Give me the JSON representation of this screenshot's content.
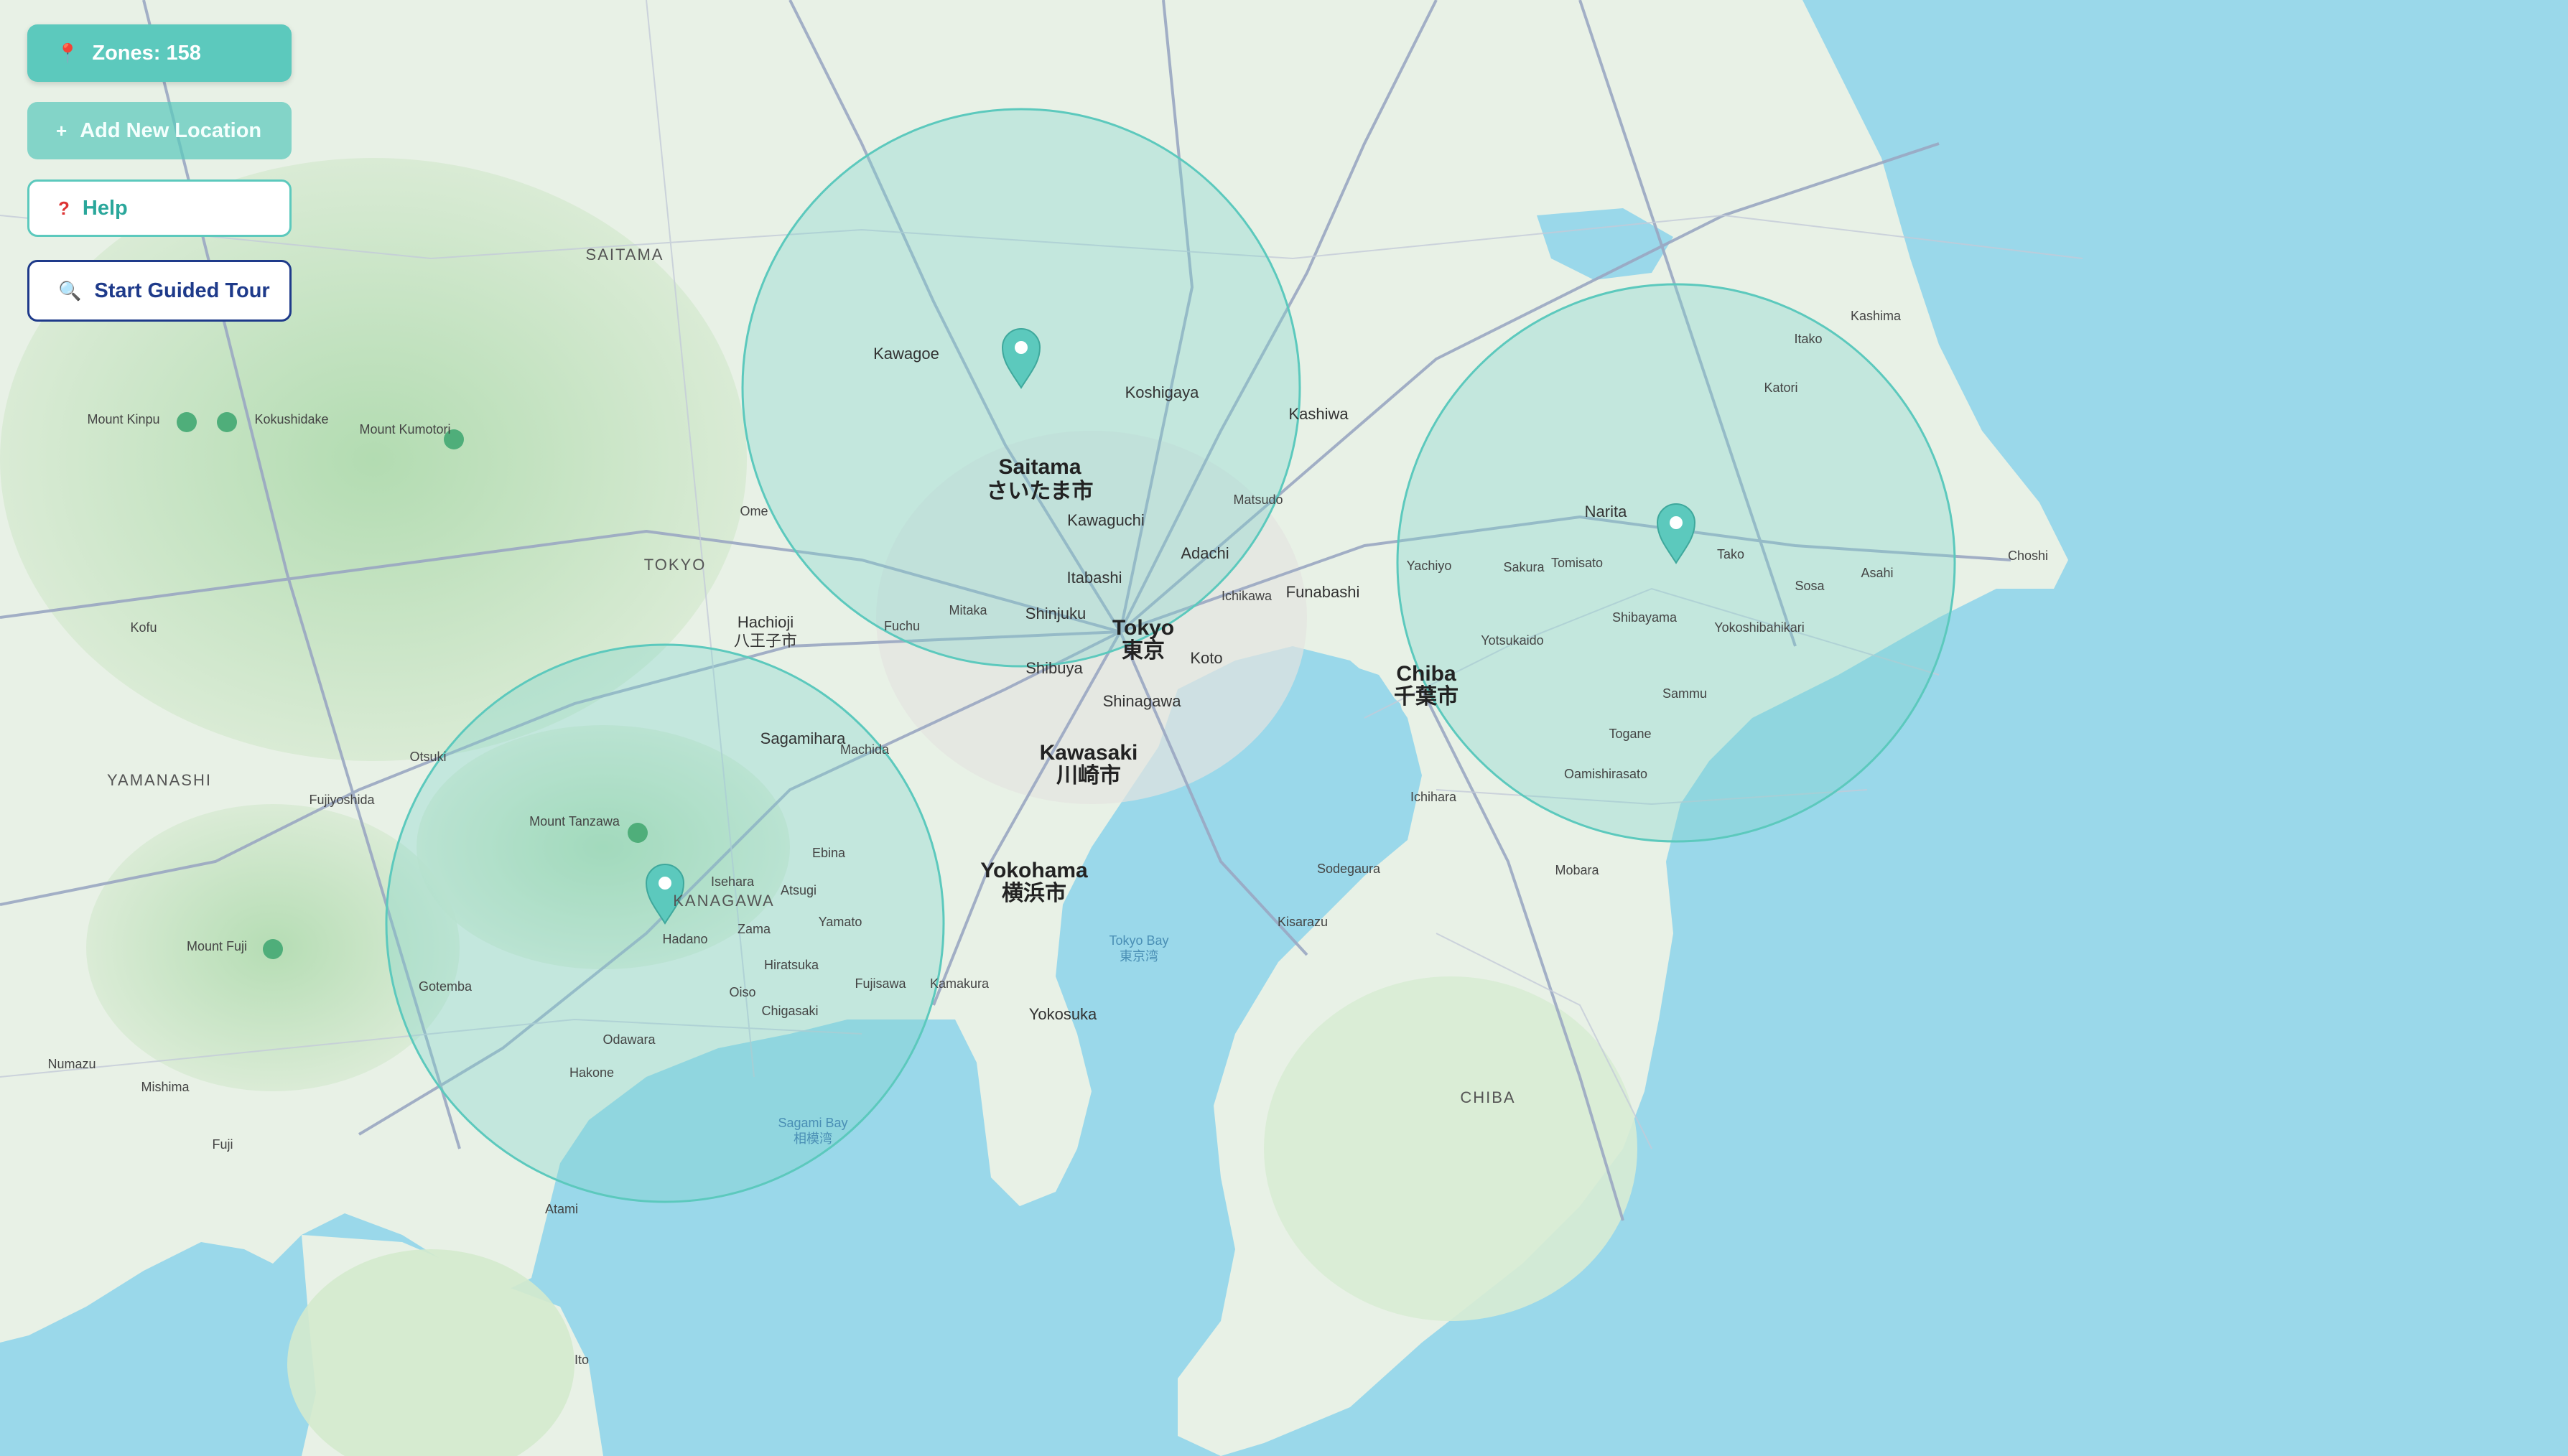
{
  "controls": {
    "zones_label": "Zones: 158",
    "zones_icon": "pin-icon",
    "add_location_label": "Add New Location",
    "add_location_icon": "plus-icon",
    "help_label": "Help",
    "help_icon": "question-icon",
    "tour_label": "Start Guided Tour",
    "tour_icon": "magnifier-icon"
  },
  "colors": {
    "accent": "#5cc9bd",
    "zone_fill": "#7fd3cc",
    "sea": "#9ad8ea",
    "land": "#e8f1e6",
    "tour_border": "#1e3a8a"
  },
  "zones": [
    {
      "name": "Saitama"
    },
    {
      "name": "Narita"
    },
    {
      "name": "Hadano"
    }
  ],
  "labels": {
    "large": [
      {
        "text": "Saitama",
        "sub": "さいたま市"
      },
      {
        "text": "Tokyo",
        "sub": "東京"
      },
      {
        "text": "Kawasaki",
        "sub": "川崎市"
      },
      {
        "text": "Yokohama",
        "sub": "横浜市"
      },
      {
        "text": "Chiba",
        "sub": "千葉市"
      },
      {
        "text": "Hachioji",
        "sub": "八王子市"
      }
    ],
    "medium": [
      "Kawagoe",
      "Koshigaya",
      "Kawaguchi",
      "Adachi",
      "Itabashi",
      "Shinjuku",
      "Shibuya",
      "Shinagawa",
      "Koto",
      "Funabashi",
      "Ichikawa",
      "Sagamihara",
      "Machida",
      "Mitaka",
      "Fuchu",
      "Kashiwa",
      "Matsudo",
      "Narita",
      "Tomisato",
      "Sakura",
      "Yachiyo",
      "Yotsukaido",
      "Kisarazu",
      "Yokosuka",
      "Kamakura",
      "Fujisawa",
      "Chigasaki",
      "Hiratsuka",
      "Odawara",
      "Atsugi",
      "Ebina",
      "Ome",
      "Tako",
      "Sosa",
      "Asahi",
      "Katori",
      "Choshi",
      "Kashima",
      "Itako",
      "Ichihara",
      "Sodegaura",
      "Mobara",
      "Togane",
      "Oamishirasato",
      "Sammu",
      "Yokoshibahikari",
      "Shibayama",
      "Yamato",
      "Zama",
      "Oiso",
      "Hadano",
      "Isehara",
      "Hakone",
      "Atami",
      "Ito",
      "Numazu",
      "Mishima",
      "Gotemba",
      "Fuji",
      "Fujiyoshida",
      "Otsuki",
      "Kofu"
    ],
    "prefectures": [
      "SAITAMA",
      "TOKYO",
      "KANAGAWA",
      "YAMANASHI",
      "CHIBA"
    ],
    "water": [
      "Tokyo Bay",
      "東京湾",
      "Sagami Bay",
      "相模湾"
    ],
    "mountains": [
      "Mount Kinpu",
      "Kokushidake",
      "Mount Kumotori",
      "Mount Tanzawa",
      "Mount Fuji"
    ]
  }
}
